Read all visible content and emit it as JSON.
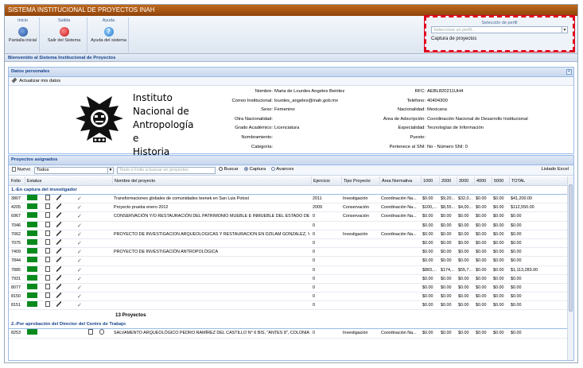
{
  "app": {
    "title": "SISTEMA INSTITUCIONAL DE PROYECTOS INAH"
  },
  "ribbon": {
    "groups": [
      {
        "title": "Inicio",
        "button": "Pantalla inicial",
        "icon": "home-icon"
      },
      {
        "title": "Salida",
        "button": "Salir del Sistema",
        "icon": "exit-icon"
      },
      {
        "title": "Ayuda",
        "button": "Ayuda del sistema",
        "icon": "help-icon"
      }
    ]
  },
  "profile": {
    "title": "Selección de perfil",
    "placeholder": "Seleccione un perfil...",
    "item": "Captura de proyectos"
  },
  "welcome": "Bienvenido al Sistema Institucional de Proyectos",
  "personal": {
    "header": "Datos personales",
    "update_label": "Actualizar mis datos",
    "logo_lines": [
      "Instituto",
      "Nacional de",
      "Antropología e",
      "Historia"
    ],
    "left_fields": [
      {
        "k": "Nombre:",
        "v": "Maria de Lourdes Angeles Benitez"
      },
      {
        "k": "Correo Institucional:",
        "v": "lourdes_angeles@inah.gob.mx"
      },
      {
        "k": "Sexo:",
        "v": "Femenino"
      },
      {
        "k": "Otra Nacionalidad:",
        "v": ""
      },
      {
        "k": "Grado Académico:",
        "v": "Licenciatura"
      },
      {
        "k": "Nombramiento:",
        "v": ""
      },
      {
        "k": "Categoría:",
        "v": ""
      }
    ],
    "right_fields": [
      {
        "k": "RFC:",
        "v": "AEBL820211UH4"
      },
      {
        "k": "Teléfono:",
        "v": "40404300"
      },
      {
        "k": "Nacionalidad:",
        "v": "Mexicana"
      },
      {
        "k": "Área de Adscripción:",
        "v": "Coordinación Nacional de Desarrollo Institucional"
      },
      {
        "k": "Especialidad:",
        "v": "Tecnologías de Información"
      },
      {
        "k": "Puesto:",
        "v": ""
      },
      {
        "k": "Pertenece al SNI:",
        "v": "No - Número SNI: 0"
      }
    ]
  },
  "projects": {
    "header": "Proyectos asignados",
    "new_label": "Nuevo",
    "filter_value": "Todos",
    "search_placeholder": "Texto o Folio a buscar en proyectos",
    "search_label": "Buscar",
    "radio_capture": "Captura",
    "radio_advances": "Avances",
    "excel_label": "Listado Excel",
    "columns": [
      "Folio",
      "Estatus",
      "Nombre del proyecto",
      "Ejercicio",
      "Tipo Proyecto",
      "Área Normativa",
      "1000",
      "2000",
      "3000",
      "4000",
      "5000",
      "TOTAL"
    ],
    "group1": {
      "title": "1.-En captura del investigador",
      "rows": [
        [
          "3807",
          "Transformaciones globales de comunidades teenek en San Luis Potosí",
          "2011",
          "Investigación",
          "Coordinación Na...",
          "$0.00",
          "$9,20...",
          "$32,0...",
          "$0.00",
          "$0.00",
          "$41,200.00"
        ],
        [
          "4205",
          "Proyecto prueba enero 2012",
          "2009",
          "Conservación",
          "Coordinación Na...",
          "$100,...",
          "$8,55...",
          "$4,00...",
          "$0.00",
          "$0.00",
          "$112,550.00"
        ],
        [
          "6967",
          "CONSERVACIÓN Y/O RESTAURACIÓN DEL PATRIMONIO MUEBLE E INMUEBLE DEL ESTADO DE TLA...",
          "0",
          "Conservación",
          "Coordinación Na...",
          "$0.00",
          "$0.00",
          "$0.00",
          "$0.00",
          "$0.00",
          "$0.00"
        ],
        [
          "7046",
          "",
          "0",
          "",
          "",
          "$0.00",
          "$0.00",
          "$0.00",
          "$0.00",
          "$0.00",
          "$0.00"
        ],
        [
          "7062",
          "PROYECTO DE INVESTIGACION ARQUEOLOGICAS Y RESTAURACION EN DZILAM GONZALEZ, YUC...",
          "0",
          "Investigación",
          "Coordinación Na...",
          "$0.00",
          "$0.00",
          "$0.00",
          "$0.00",
          "$0.00",
          "$0.00"
        ],
        [
          "7075",
          "",
          "0",
          "",
          "",
          "$0.00",
          "$0.00",
          "$0.00",
          "$0.00",
          "$0.00",
          "$0.00"
        ],
        [
          "7409",
          "PROYECTO DE INVESTIGACIÓN ANTROPOLÓGICA",
          "0",
          "",
          "",
          "$0.00",
          "$0.00",
          "$0.00",
          "$0.00",
          "$0.00",
          "$0.00"
        ],
        [
          "7844",
          "",
          "0",
          "",
          "",
          "$0.00",
          "$0.00",
          "$0.00",
          "$0.00",
          "$0.00",
          "$0.00"
        ],
        [
          "7885",
          "",
          "0",
          "",
          "",
          "$883,...",
          "$174,...",
          "$55,7...",
          "$0.00",
          "$0.00",
          "$1,113,283.00"
        ],
        [
          "7931",
          "",
          "0",
          "",
          "",
          "$0.00",
          "$0.00",
          "$0.00",
          "$0.00",
          "$0.00",
          "$0.00"
        ],
        [
          "8077",
          "",
          "0",
          "",
          "",
          "$0.00",
          "$0.00",
          "$0.00",
          "$0.00",
          "$0.00",
          "$0.00"
        ],
        [
          "8150",
          "",
          "0",
          "",
          "",
          "$0.00",
          "$0.00",
          "$0.00",
          "$0.00",
          "$0.00",
          "$0.00"
        ],
        [
          "8151",
          "",
          "0",
          "",
          "",
          "$0.00",
          "$0.00",
          "$0.00",
          "$0.00",
          "$0.00",
          "$0.00"
        ]
      ],
      "summary": "13 Proyectos"
    },
    "group2": {
      "title": "2.-Por aprobación del Director del Centro de Trabajo",
      "rows": [
        [
          "8253",
          "SALVAMENTO ARQUEOLÓGICO PEDRO RAMÍREZ DEL CASTILLO N° 6 BIS, \"ANTES 8\", COLONIA BA...",
          "0",
          "Investigación",
          "Coordinación Na...",
          "$0.00",
          "$0.00",
          "$0.00",
          "$0.00",
          "$0.00",
          "$0.00"
        ]
      ]
    }
  },
  "colors": {
    "title_bar": "#a9561a",
    "accent": "#15428b",
    "status_green": "#0a8a1e",
    "highlight": "#e0001b"
  }
}
